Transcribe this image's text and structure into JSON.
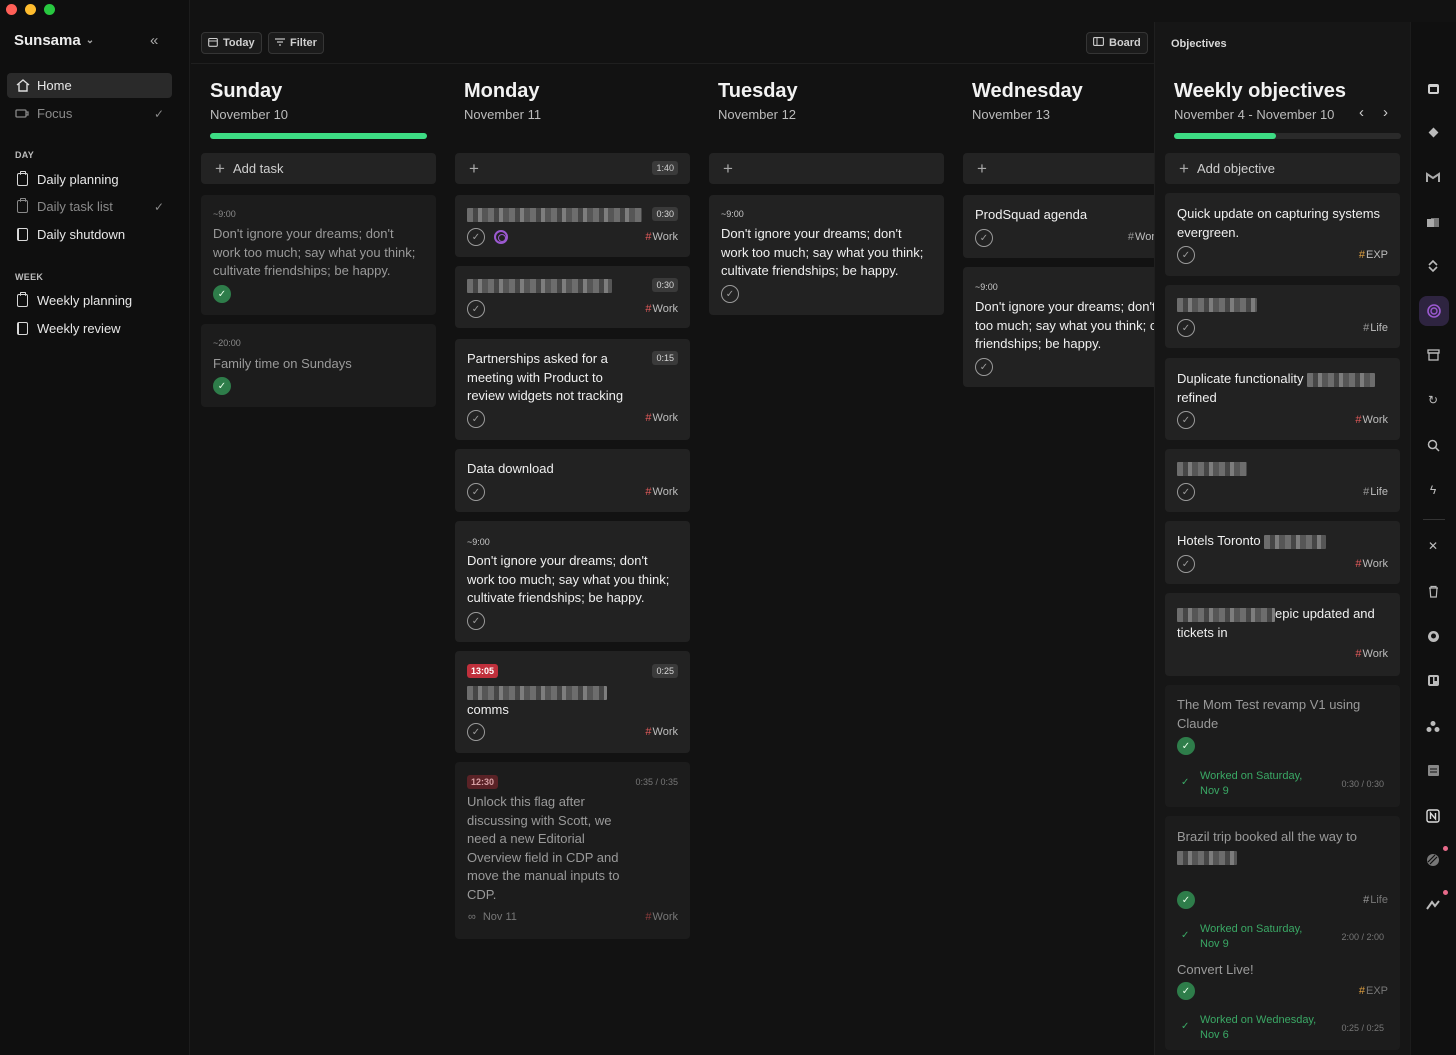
{
  "window": {
    "controls": [
      "#ff5f57",
      "#febc2e",
      "#28c840"
    ]
  },
  "sidebar": {
    "app_name": "Sunsama",
    "nav": [
      {
        "label": "Home"
      },
      {
        "label": "Focus"
      }
    ],
    "day_section": "DAY",
    "day_items": [
      {
        "label": "Daily planning"
      },
      {
        "label": "Daily task list"
      },
      {
        "label": "Daily shutdown"
      }
    ],
    "week_section": "WEEK",
    "week_items": [
      {
        "label": "Weekly planning"
      },
      {
        "label": "Weekly review"
      }
    ]
  },
  "toolbar": {
    "today": "Today",
    "filter": "Filter",
    "board": "Board"
  },
  "colors": {
    "accent_green": "#3ddc84",
    "tag_red": "#e05a5a",
    "tag_orange": "#e0a040",
    "badge_red": "#c0303c"
  },
  "days": [
    {
      "name": "Sunday",
      "date": "November 10",
      "add_label": "Add task",
      "progress": 1.0,
      "tasks": [
        {
          "time": "~9:00",
          "title": "Don't ignore your dreams; don't work too much; say what you think; cultivate friendships; be happy."
        },
        {
          "time": "~20:00",
          "title": "Family time on Sundays"
        }
      ]
    },
    {
      "name": "Monday",
      "date": "November 11",
      "add_label": "",
      "total": "1:40",
      "tasks": [
        {
          "duration": "0:30",
          "tag": "Work"
        },
        {
          "duration": "0:30",
          "tag": "Work"
        },
        {
          "title": "Partnerships asked for a meeting with Product to review widgets not tracking",
          "duration": "0:15",
          "tag": "Work"
        },
        {
          "title": "Data download",
          "tag": "Work"
        },
        {
          "time": "~9:00",
          "title": "Don't ignore your dreams; don't work too much; say what you think; cultivate friendships; be happy."
        },
        {
          "badge": "13:05",
          "title": "comms",
          "duration": "0:25",
          "tag": "Work"
        },
        {
          "badge": "12:30",
          "title": "Unlock this flag after discussing with Scott, we need a new Editorial Overview field in CDP and move the manual inputs to CDP.",
          "duration": "0:35 / 0:35",
          "date": "Nov 11",
          "tag": "Work"
        }
      ]
    },
    {
      "name": "Tuesday",
      "date": "November 12",
      "add_label": "",
      "tasks": [
        {
          "time": "~9:00",
          "title": "Don't ignore your dreams; don't work too much; say what you think; cultivate friendships; be happy."
        }
      ]
    },
    {
      "name": "Wednesday",
      "date": "November 13",
      "add_label": "",
      "tasks": [
        {
          "title": "ProdSquad agenda",
          "tag": "Wor"
        },
        {
          "time": "~9:00",
          "title": "Don't ignore your dreams; don't work too much; say what you think; cultivate friendships; be happy."
        }
      ]
    }
  ],
  "objectives": {
    "panel_title": "Objectives",
    "title": "Weekly objectives",
    "range": "November 4 - November 10",
    "progress": 0.45,
    "add_label": "Add objective",
    "items": [
      {
        "title": "Quick update  on capturing systems evergreen.",
        "tag": "EXP"
      },
      {
        "title": "",
        "tag": "Life"
      },
      {
        "title": "Duplicate functionality",
        "title2": "refined",
        "tag": "Work"
      },
      {
        "title": "",
        "tag": "Life"
      },
      {
        "title": "Hotels Toronto",
        "tag": "Work"
      },
      {
        "title": "epic updated and",
        "title2": "tickets in",
        "tag": "Work"
      },
      {
        "title": "The Mom Test revamp V1 using Claude",
        "worked": "Worked on Saturday, Nov 9",
        "duration": "0:30 / 0:30"
      },
      {
        "title": "Brazil trip booked all the way to",
        "tag": "Life",
        "worked": "Worked on Saturday, Nov 9",
        "duration": "2:00 / 2:00"
      },
      {
        "title": "Convert Live!",
        "tag": "EXP",
        "worked": "Worked on Wednesday, Nov 6",
        "duration": "0:25 / 0:25"
      }
    ]
  },
  "rail_icons": [
    "calendar-icon",
    "diamond-icon",
    "gmail-icon",
    "outlook-icon",
    "sync-icon",
    "objectives-icon",
    "archive-icon",
    "refresh-icon",
    "search-icon",
    "bolt-icon",
    "close-icon",
    "trash-icon",
    "github-icon",
    "trello-icon",
    "asana-icon",
    "notes-icon",
    "notion-icon",
    "linear-icon",
    "clickup-icon"
  ]
}
